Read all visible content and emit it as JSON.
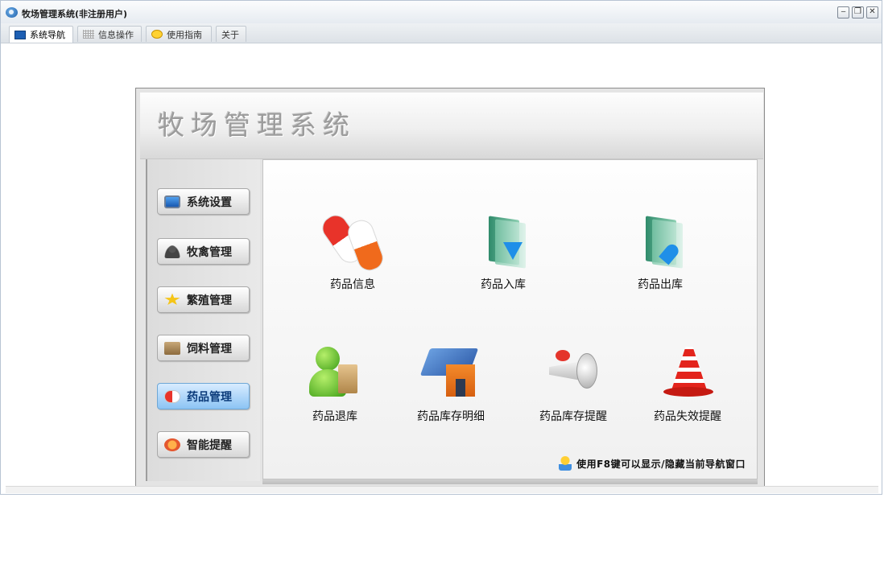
{
  "window": {
    "title": "牧场管理系统(非注册用户)",
    "controls": [
      "‒",
      "❐",
      "✕"
    ]
  },
  "tabs": [
    {
      "label": "系统导航",
      "icon": "monitor-icon",
      "active": true
    },
    {
      "label": "信息操作",
      "icon": "grid-icon",
      "active": false
    },
    {
      "label": "使用指南",
      "icon": "smiley-icon",
      "active": false
    },
    {
      "label": "关于",
      "icon": "",
      "active": false
    }
  ],
  "banner": {
    "title": "牧场管理系统"
  },
  "sidebar": {
    "items": [
      {
        "label": "系统设置",
        "icon": "monitor-icon"
      },
      {
        "label": "牧禽管理",
        "icon": "user-icon"
      },
      {
        "label": "繁殖管理",
        "icon": "star-icon"
      },
      {
        "label": "饲料管理",
        "icon": "folder-icon"
      },
      {
        "label": "药品管理",
        "icon": "pill-icon",
        "active": true
      },
      {
        "label": "智能提醒",
        "icon": "face-icon"
      }
    ]
  },
  "main": {
    "items": [
      {
        "label": "药品信息",
        "icon": "capsule-icon"
      },
      {
        "label": "药品入库",
        "icon": "folder-in-icon"
      },
      {
        "label": "药品出库",
        "icon": "folder-out-icon"
      },
      {
        "label": "药品退库",
        "icon": "person-bag-icon"
      },
      {
        "label": "药品库存明细",
        "icon": "house-icon"
      },
      {
        "label": "药品库存提醒",
        "icon": "megaphone-icon"
      },
      {
        "label": "药品失效提醒",
        "icon": "alarm-cone-icon"
      }
    ],
    "hint": "使用F8键可以显示/隐藏当前导航窗口"
  },
  "colors": {
    "active_nav": "#8cc4f4",
    "pill_red": "#e8332a",
    "arrow_blue": "#1f8fe8"
  }
}
